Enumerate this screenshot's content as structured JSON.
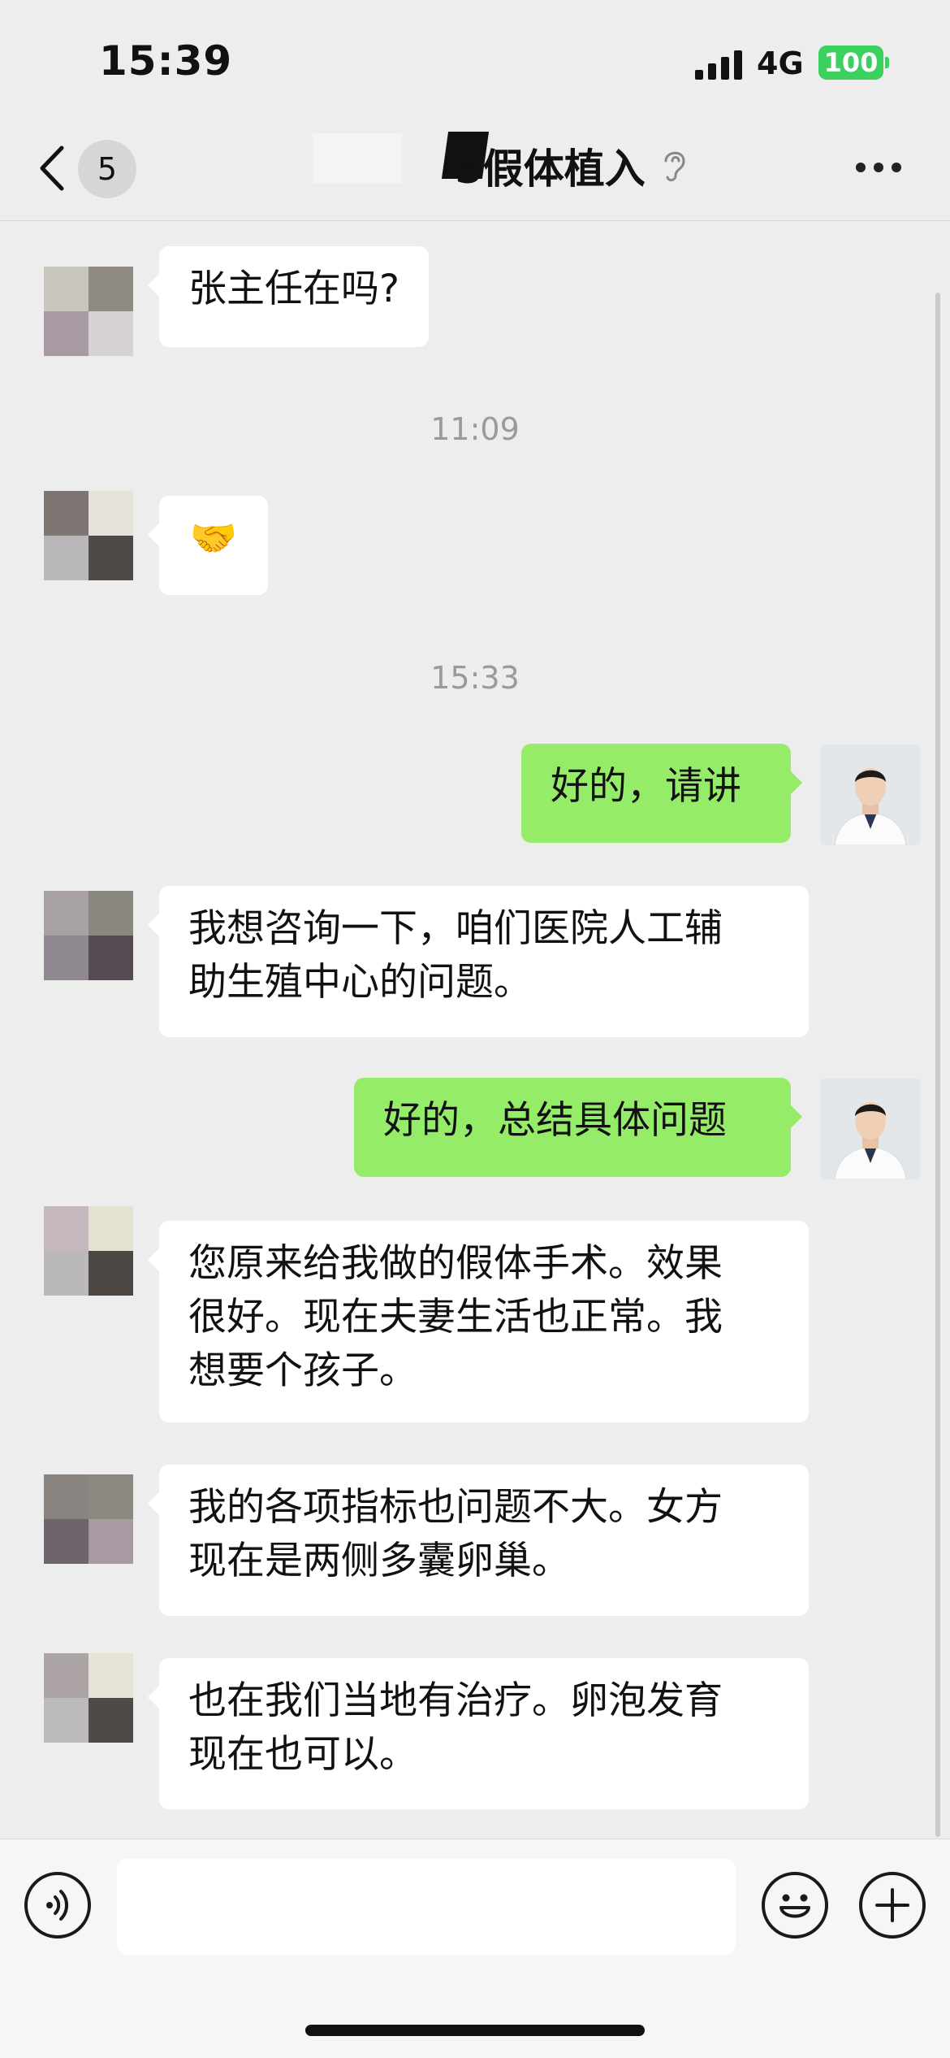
{
  "status_bar": {
    "time": "15:39",
    "network": "4G",
    "battery": "100"
  },
  "header": {
    "back_icon": "chevron-left-icon",
    "unread_count": "5",
    "title": "5假体植入",
    "mute_icon": "ear-icon",
    "more_icon": "more-dots-icon"
  },
  "messages": [
    {
      "direction": "in",
      "text": "张主任在吗?"
    },
    {
      "type": "timestamp",
      "text": "11:09"
    },
    {
      "direction": "in",
      "text": "🤝"
    },
    {
      "type": "timestamp",
      "text": "15:33"
    },
    {
      "direction": "out",
      "text": "好的，请讲"
    },
    {
      "direction": "in",
      "lines": [
        "我想咨询一下，咱们医院人工辅",
        "助生殖中心的问题。"
      ]
    },
    {
      "direction": "out",
      "text": "好的，总结具体问题"
    },
    {
      "direction": "in",
      "lines": [
        "您原来给我做的假体手术。效果",
        "很好。现在夫妻生活也正常。我",
        "想要个孩子。"
      ]
    },
    {
      "direction": "in",
      "lines": [
        "我的各项指标也问题不大。女方",
        "现在是两侧多囊卵巢。"
      ]
    },
    {
      "direction": "in",
      "lines": [
        "也在我们当地有治疗。卵泡发育",
        "现在也可以。"
      ]
    }
  ],
  "input_bar": {
    "voice_icon": "voice-icon",
    "emoji_icon": "emoji-icon",
    "plus_icon": "plus-icon",
    "input_value": ""
  },
  "colors": {
    "background": "#ededed",
    "outgoing_bubble": "#95ec69",
    "incoming_bubble": "#ffffff",
    "battery": "#3cd15e"
  }
}
